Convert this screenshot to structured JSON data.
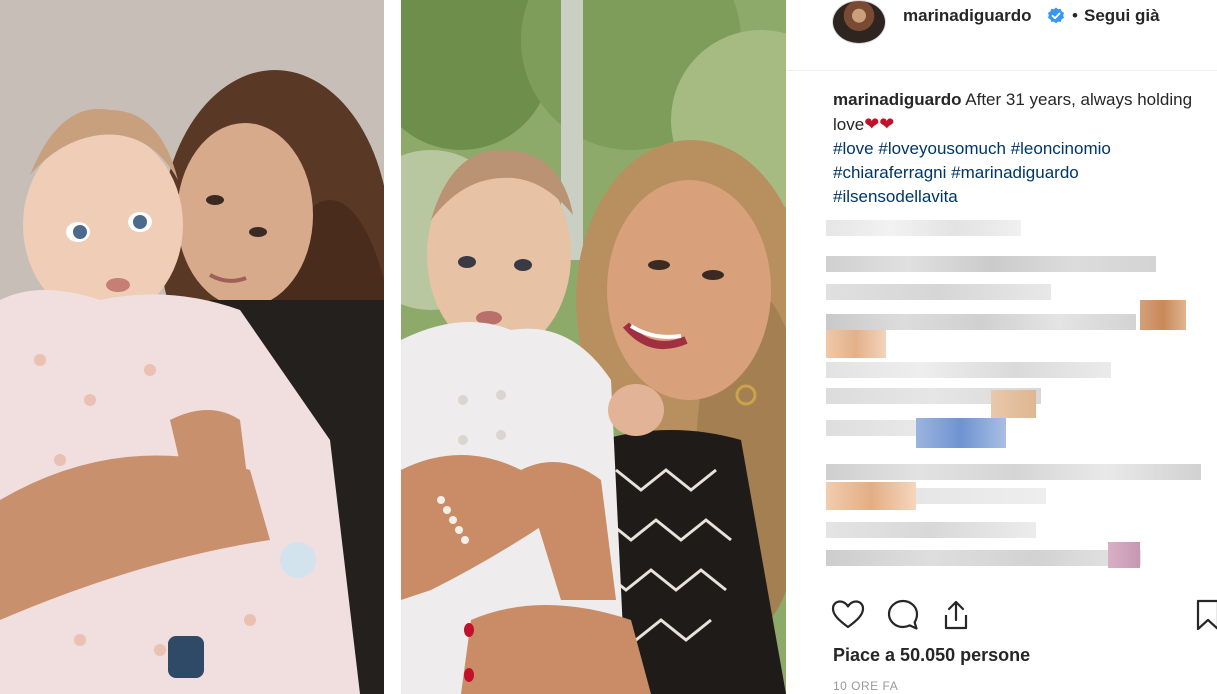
{
  "post": {
    "username": "marinadiguardo",
    "follow_status": "Segui già",
    "separator": "•"
  },
  "caption": {
    "username": "marinadiguardo",
    "text": "After 31 years, always holding love",
    "emoji": "❤❤",
    "hashtags": [
      "#love",
      "#loveyousomuch",
      "#leoncinomio",
      "#chiaraferragni",
      "#marinadiguardo",
      "#ilsensodellavita"
    ]
  },
  "actions": {
    "like_icon": "heart-icon",
    "comment_icon": "comment-icon",
    "share_icon": "share-icon",
    "save_icon": "bookmark-icon"
  },
  "stats": {
    "likes_text": "Piace a 50.050 persone",
    "time_ago": "10 ORE FA"
  },
  "colors": {
    "text": "#262626",
    "hashtag": "#003569",
    "verified": "#3897f0",
    "muted": "#999999"
  }
}
